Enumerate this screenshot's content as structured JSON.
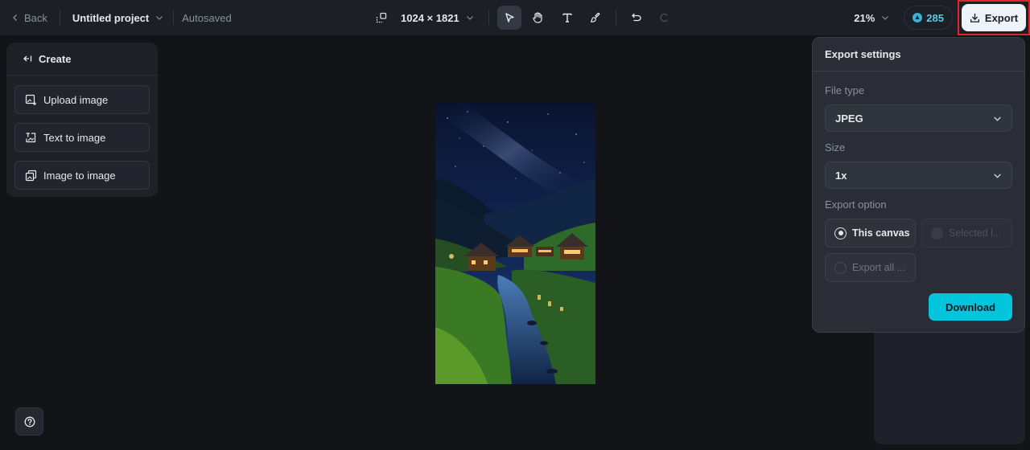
{
  "topbar": {
    "back_label": "Back",
    "project_name": "Untitled project",
    "save_status": "Autosaved",
    "canvas_dimensions": "1024 × 1821",
    "tools": [
      {
        "name": "select",
        "icon": "pointer-icon",
        "active": true
      },
      {
        "name": "hand",
        "icon": "hand-icon",
        "active": false
      },
      {
        "name": "text",
        "icon": "text-icon",
        "active": false
      },
      {
        "name": "brush",
        "icon": "brush-icon",
        "active": false
      }
    ],
    "undo_icon": "undo-icon",
    "redo_icon": "redo-icon",
    "zoom_level": "21%",
    "credits": "285",
    "export_label": "Export"
  },
  "create_panel": {
    "title": "Create",
    "items": [
      {
        "label": "Upload image",
        "icon": "upload-image-icon"
      },
      {
        "label": "Text to image",
        "icon": "text-to-image-icon"
      },
      {
        "label": "Image to image",
        "icon": "image-to-image-icon"
      }
    ]
  },
  "canvas": {
    "image_description": "Night mountain village with river and milky way"
  },
  "export_settings": {
    "title": "Export settings",
    "file_type_label": "File type",
    "file_type_value": "JPEG",
    "size_label": "Size",
    "size_value": "1x",
    "export_option_label": "Export option",
    "options": [
      {
        "label": "This canvas",
        "state": "selected"
      },
      {
        "label": "Selected l...",
        "state": "disabled"
      },
      {
        "label": "Export all ...",
        "state": "unselected"
      }
    ],
    "download_label": "Download"
  },
  "colors": {
    "accent": "#00c5dd",
    "credits": "#5dc8e0",
    "highlight_border": "#e5232c"
  }
}
